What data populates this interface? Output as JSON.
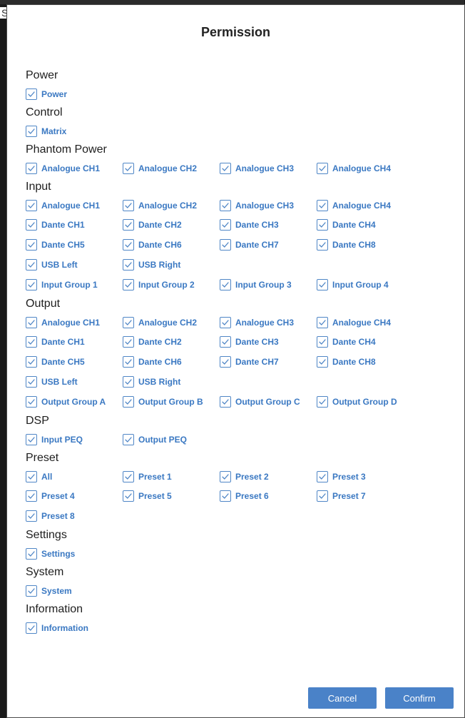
{
  "stray_char": "S",
  "dialog": {
    "title": "Permission",
    "cancel_label": "Cancel",
    "confirm_label": "Confirm"
  },
  "colors": {
    "accent": "#3a78c2",
    "button": "#4a82c8",
    "checkbox_border": "#4f86c6"
  },
  "sections": {
    "power": {
      "title": "Power",
      "rows": [
        [
          "Power"
        ]
      ]
    },
    "control": {
      "title": "Control",
      "rows": [
        [
          "Matrix"
        ]
      ]
    },
    "phantom": {
      "title": "Phantom Power",
      "rows": [
        [
          "Analogue CH1",
          "Analogue CH2",
          "Analogue CH3",
          "Analogue CH4"
        ]
      ]
    },
    "input": {
      "title": "Input",
      "rows": [
        [
          "Analogue CH1",
          "Analogue CH2",
          "Analogue CH3",
          "Analogue CH4"
        ],
        [
          "Dante CH1",
          "Dante CH2",
          "Dante CH3",
          "Dante CH4"
        ],
        [
          "Dante CH5",
          "Dante CH6",
          "Dante CH7",
          "Dante CH8"
        ],
        [
          "USB Left",
          "USB Right"
        ],
        [
          "Input Group 1",
          "Input Group 2",
          "Input Group 3",
          "Input Group 4"
        ]
      ]
    },
    "output": {
      "title": "Output",
      "rows": [
        [
          "Analogue CH1",
          "Analogue CH2",
          "Analogue CH3",
          "Analogue CH4"
        ],
        [
          "Dante CH1",
          "Dante CH2",
          "Dante CH3",
          "Dante CH4"
        ],
        [
          "Dante CH5",
          "Dante CH6",
          "Dante CH7",
          "Dante CH8"
        ],
        [
          "USB Left",
          "USB Right"
        ],
        [
          "Output Group A",
          "Output Group B",
          "Output Group C",
          "Output Group D"
        ]
      ]
    },
    "dsp": {
      "title": "DSP",
      "rows": [
        [
          "Input PEQ",
          "Output PEQ"
        ]
      ]
    },
    "preset": {
      "title": "Preset",
      "rows": [
        [
          "All",
          "Preset 1",
          "Preset 2",
          "Preset 3"
        ],
        [
          "Preset 4",
          "Preset 5",
          "Preset 6",
          "Preset 7"
        ],
        [
          "Preset 8"
        ]
      ]
    },
    "settings": {
      "title": "Settings",
      "rows": [
        [
          "Settings"
        ]
      ]
    },
    "system": {
      "title": "System",
      "rows": [
        [
          "System"
        ]
      ]
    },
    "information": {
      "title": "Information",
      "rows": [
        [
          "Information"
        ]
      ]
    }
  },
  "checkbox_state": "checked",
  "check_icon": "checkmark-icon"
}
